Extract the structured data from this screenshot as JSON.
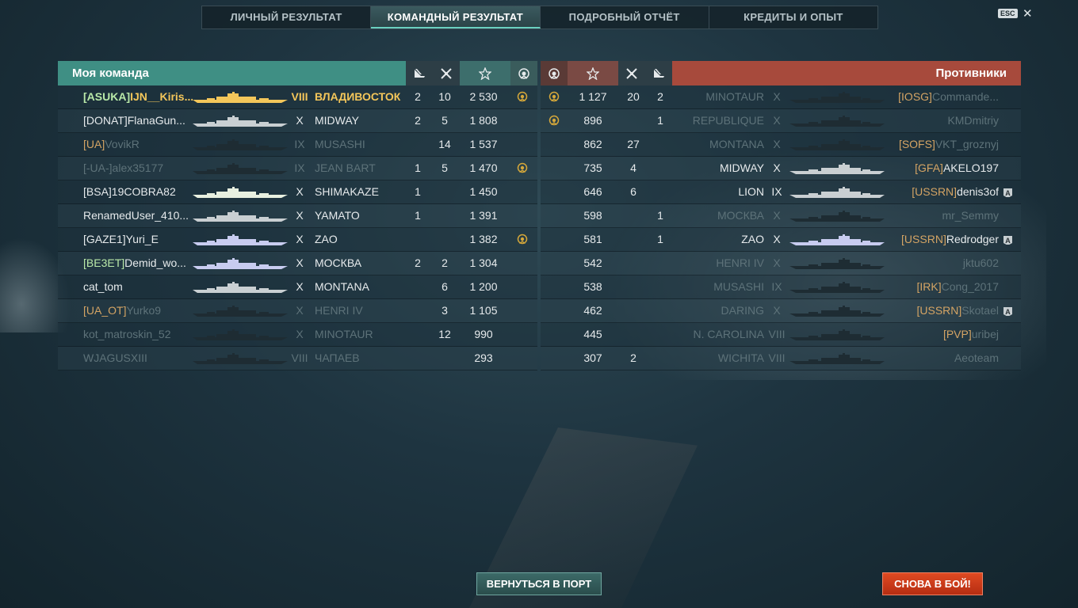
{
  "tabs": [
    "ЛИЧНЫЙ РЕЗУЛЬТАТ",
    "КОМАНДНЫЙ РЕЗУЛЬТАТ",
    "ПОДРОБНЫЙ ОТЧЁТ",
    "КРЕДИТЫ И ОПЫТ"
  ],
  "active_tab": 1,
  "esc_label": "ESC",
  "close_glyph": "✕",
  "my_team": {
    "title": "Моя команда",
    "header_icons": [
      "ship-kill-icon",
      "plane-kill-icon",
      "star-icon",
      "ribbon-icon"
    ],
    "rows": [
      {
        "clan": "[ASUKA]",
        "name": "IJN__Kiris...",
        "tier": "VIII",
        "ship": "ВЛАДИВОСТОК",
        "c1": "2",
        "c2": "10",
        "xp": "2 530",
        "medal": true,
        "style": "me",
        "sil": "#f3c65a"
      },
      {
        "clan": "",
        "name": "[DONAT]FlanaGun...",
        "tier": "X",
        "ship": "MIDWAY",
        "c1": "2",
        "c2": "5",
        "xp": "1 808",
        "medal": false,
        "style": "alive",
        "sil": "#c9cfd2"
      },
      {
        "clan": "[UA]",
        "name": "VovikR",
        "tier": "IX",
        "ship": "MUSASHI",
        "c1": "",
        "c2": "14",
        "xp": "1 537",
        "medal": false,
        "style": "dead",
        "sil": "#1e2c33"
      },
      {
        "clan": "",
        "name": "[-UA-]alex35177",
        "tier": "IX",
        "ship": "JEAN BART",
        "c1": "1",
        "c2": "5",
        "xp": "1 470",
        "medal": true,
        "style": "dead",
        "sil": "#1e2c33"
      },
      {
        "clan": "",
        "name": "[BSA]19COBRA82",
        "tier": "X",
        "ship": "SHIMAKAZE",
        "c1": "1",
        "c2": "",
        "xp": "1 450",
        "medal": false,
        "style": "alive",
        "sil": "#e8f0e0"
      },
      {
        "clan": "",
        "name": "RenamedUser_410...",
        "tier": "X",
        "ship": "YAMATO",
        "c1": "1",
        "c2": "",
        "xp": "1 391",
        "medal": false,
        "style": "alive",
        "sil": "#c9cfd2"
      },
      {
        "clan": "",
        "name": "[GAZE1]Yuri_E",
        "tier": "X",
        "ship": "ZAO",
        "c1": "",
        "c2": "",
        "xp": "1 382",
        "medal": true,
        "style": "alive",
        "sil": "#c8ccf0"
      },
      {
        "clan": "[BE3ET]",
        "name": "Demid_wo...",
        "tier": "X",
        "ship": "МОСКВА",
        "c1": "2",
        "c2": "2",
        "xp": "1 304",
        "medal": false,
        "style": "alive",
        "sil": "#c8ccf0"
      },
      {
        "clan": "",
        "name": "cat_tom",
        "tier": "X",
        "ship": "MONTANA",
        "c1": "",
        "c2": "6",
        "xp": "1 200",
        "medal": false,
        "style": "alive",
        "sil": "#c9cfd2"
      },
      {
        "clan": "[UA_OT]",
        "name": "Yurko9",
        "tier": "X",
        "ship": "HENRI IV",
        "c1": "",
        "c2": "3",
        "xp": "1 105",
        "medal": false,
        "style": "dead",
        "sil": "#1e2c33"
      },
      {
        "clan": "",
        "name": "kot_matroskin_52",
        "tier": "X",
        "ship": "MINOTAUR",
        "c1": "",
        "c2": "12",
        "xp": "990",
        "medal": false,
        "style": "dead",
        "sil": "#1e2c33"
      },
      {
        "clan": "",
        "name": "WJAGUSXIII",
        "tier": "VIII",
        "ship": "ЧАПАЕВ",
        "c1": "",
        "c2": "",
        "xp": "293",
        "medal": false,
        "style": "dead",
        "sil": "#1e2c33"
      }
    ]
  },
  "enemy_team": {
    "title": "Противники",
    "header_icons": [
      "ribbon-icon",
      "star-icon",
      "plane-kill-icon",
      "ship-kill-icon"
    ],
    "rows": [
      {
        "medal": true,
        "xp": "1 127",
        "c2": "20",
        "c1": "2",
        "ship": "MINOTAUR",
        "tier": "X",
        "clan": "[IOSG]",
        "name": "Commande...",
        "div": false,
        "style": "dead",
        "sil": "#1e2c33"
      },
      {
        "medal": true,
        "xp": "896",
        "c2": "",
        "c1": "1",
        "ship": "REPUBLIQUE",
        "tier": "X",
        "clan": "",
        "name": "KMDmitriy",
        "div": false,
        "style": "dead",
        "sil": "#1e2c33"
      },
      {
        "medal": false,
        "xp": "862",
        "c2": "27",
        "c1": "",
        "ship": "MONTANA",
        "tier": "X",
        "clan": "[SOFS]",
        "name": "VKT_groznyj",
        "div": false,
        "style": "dead",
        "sil": "#1e2c33"
      },
      {
        "medal": false,
        "xp": "735",
        "c2": "4",
        "c1": "",
        "ship": "MIDWAY",
        "tier": "X",
        "clan": "[GFA]",
        "name": "AKELO197",
        "div": false,
        "style": "alive",
        "sil": "#c9cfd2"
      },
      {
        "medal": false,
        "xp": "646",
        "c2": "6",
        "c1": "",
        "ship": "LION",
        "tier": "IX",
        "clan": "[USSRN]",
        "name": "denis3of",
        "div": true,
        "style": "alive",
        "sil": "#c9cfd2"
      },
      {
        "medal": false,
        "xp": "598",
        "c2": "",
        "c1": "1",
        "ship": "МОСКВА",
        "tier": "X",
        "clan": "",
        "name": "mr_Semmy",
        "div": false,
        "style": "dead",
        "sil": "#1e2c33"
      },
      {
        "medal": false,
        "xp": "581",
        "c2": "",
        "c1": "1",
        "ship": "ZAO",
        "tier": "X",
        "clan": "[USSRN]",
        "name": "Redrodger",
        "div": true,
        "style": "alive",
        "sil": "#c8ccf0"
      },
      {
        "medal": false,
        "xp": "542",
        "c2": "",
        "c1": "",
        "ship": "HENRI IV",
        "tier": "X",
        "clan": "",
        "name": "jktu602",
        "div": false,
        "style": "dead",
        "sil": "#1e2c33"
      },
      {
        "medal": false,
        "xp": "538",
        "c2": "",
        "c1": "",
        "ship": "MUSASHI",
        "tier": "IX",
        "clan": "[IRK]",
        "name": "Cong_2017",
        "div": false,
        "style": "dead",
        "sil": "#1e2c33"
      },
      {
        "medal": false,
        "xp": "462",
        "c2": "",
        "c1": "",
        "ship": "DARING",
        "tier": "X",
        "clan": "[USSRN]",
        "name": "Skotael",
        "div": true,
        "style": "dead",
        "sil": "#1e2c33"
      },
      {
        "medal": false,
        "xp": "445",
        "c2": "",
        "c1": "",
        "ship": "N. CAROLINA",
        "tier": "VIII",
        "clan": "[PVP]",
        "name": "uribej",
        "div": false,
        "style": "dead",
        "sil": "#1e2c33"
      },
      {
        "medal": false,
        "xp": "307",
        "c2": "2",
        "c1": "",
        "ship": "WICHITA",
        "tier": "VIII",
        "clan": "",
        "name": "Aeoteam",
        "div": false,
        "style": "dead",
        "sil": "#1e2c33"
      }
    ]
  },
  "division_badge_label": "A",
  "buttons": {
    "port": "ВЕРНУТЬСЯ В ПОРТ",
    "battle": "СНОВА В БОЙ!"
  }
}
